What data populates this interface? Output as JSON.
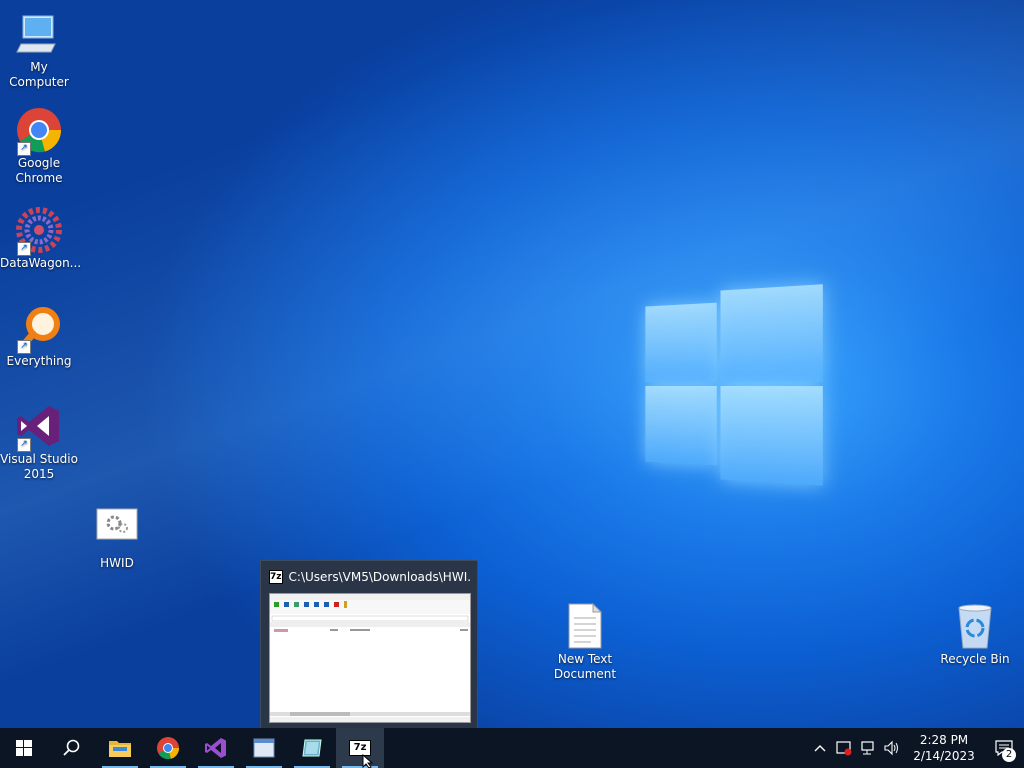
{
  "desktop": {
    "icons": [
      {
        "label": "My Computer",
        "icon": "computer-icon"
      },
      {
        "label": "Google Chrome",
        "icon": "chrome-icon"
      },
      {
        "label": "DataWagon...",
        "icon": "datawagon-icon"
      },
      {
        "label": "Everything",
        "icon": "search-magnifier-icon"
      },
      {
        "label": "Visual Studio 2015",
        "icon": "visual-studio-icon"
      },
      {
        "label": "HWID",
        "icon": "gear-file-icon"
      },
      {
        "label": "New Text Document",
        "icon": "text-document-icon"
      },
      {
        "label": "Recycle Bin",
        "icon": "recycle-bin-icon"
      }
    ]
  },
  "preview": {
    "title": "C:\\Users\\VM5\\Downloads\\HWI...",
    "badge": "7z"
  },
  "taskbar": {
    "start": "windows-start-icon",
    "search": "search-icon",
    "apps": [
      {
        "name": "File Explorer",
        "icon": "folder-icon"
      },
      {
        "name": "Google Chrome",
        "icon": "chrome-icon"
      },
      {
        "name": "Visual Studio",
        "icon": "visual-studio-icon"
      },
      {
        "name": "Window",
        "icon": "window-icon"
      },
      {
        "name": "App",
        "icon": "app-icon"
      },
      {
        "name": "7-Zip",
        "icon": "sevenzip-icon",
        "label": "7z"
      }
    ],
    "tray": {
      "time": "2:28 PM",
      "date": "2/14/2023",
      "notification_count": "2"
    }
  },
  "colors": {
    "taskbar": "#0b1523",
    "accent": "#76b9ed"
  }
}
